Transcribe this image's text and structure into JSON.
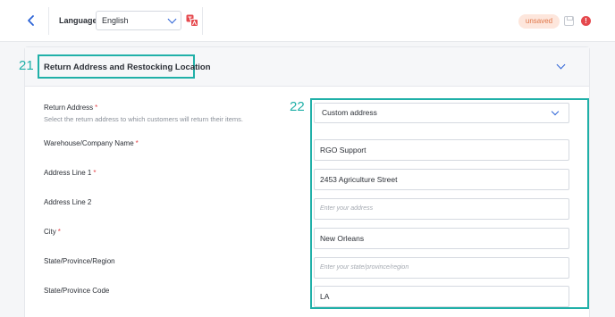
{
  "toolbar": {
    "back_icon": "chevron-left-icon",
    "language_label": "Language",
    "language_value": "English",
    "translate_icon": "translate-icon",
    "unsaved_badge": "unsaved",
    "save_icon": "save-icon",
    "alert_icon": "alert-icon",
    "alert_glyph": "!"
  },
  "section": {
    "title": "Return Address and Restocking Location",
    "collapse_icon": "chevron-down-icon"
  },
  "callouts": {
    "first": "21",
    "second": "22"
  },
  "form": {
    "return_address": {
      "label": "Return Address",
      "required_mark": "*",
      "help": "Select the return address to which customers will return their items.",
      "value": "Custom address"
    },
    "company_name": {
      "label": "Warehouse/Company Name",
      "required_mark": "*",
      "value": "RGO Support"
    },
    "address_line_1": {
      "label": "Address Line 1",
      "required_mark": "*",
      "value": "2453 Agriculture Street"
    },
    "address_line_2": {
      "label": "Address Line 2",
      "value": "",
      "placeholder": "Enter your address"
    },
    "city": {
      "label": "City",
      "required_mark": "*",
      "value": "New Orleans"
    },
    "state_region": {
      "label": "State/Province/Region",
      "value": "",
      "placeholder": "Enter your state/province/region"
    },
    "state_code": {
      "label": "State/Province Code",
      "value": "LA"
    }
  },
  "colors": {
    "accent": "#2c63d6",
    "callout": "#20b0a8",
    "required": "#e5484d",
    "unsaved_bg": "#fde6dc",
    "unsaved_text": "#e0774a"
  }
}
